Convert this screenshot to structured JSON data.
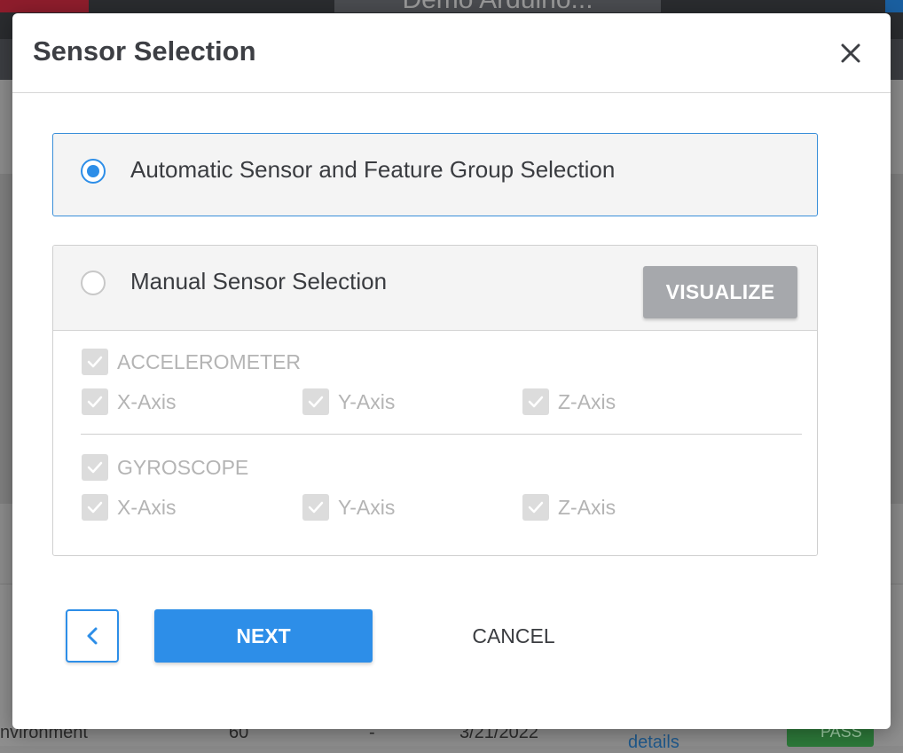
{
  "background": {
    "title_fragment": "Demo Arduino...",
    "row": {
      "name": "nvironment",
      "count": "60",
      "dash": "-",
      "date": "3/21/2022",
      "link": "details",
      "badge": "PASS"
    }
  },
  "modal": {
    "title": "Sensor Selection",
    "options": {
      "automatic_label": "Automatic Sensor and Feature Group Selection",
      "manual_label": "Manual Sensor Selection",
      "visualize_label": "VISUALIZE"
    },
    "sensors": {
      "accelerometer": {
        "label": "ACCELEROMETER",
        "x": "X-Axis",
        "y": "Y-Axis",
        "z": "Z-Axis"
      },
      "gyroscope": {
        "label": "GYROSCOPE",
        "x": "X-Axis",
        "y": "Y-Axis",
        "z": "Z-Axis"
      }
    },
    "footer": {
      "next_label": "NEXT",
      "cancel_label": "CANCEL"
    }
  },
  "icons": {
    "close": "close-icon",
    "back": "chevron-left-icon",
    "check": "checkmark-icon"
  },
  "colors": {
    "accent": "#2d8ee8",
    "disabled_button": "#a6a8ac",
    "disabled_text": "#b4b4b4"
  }
}
